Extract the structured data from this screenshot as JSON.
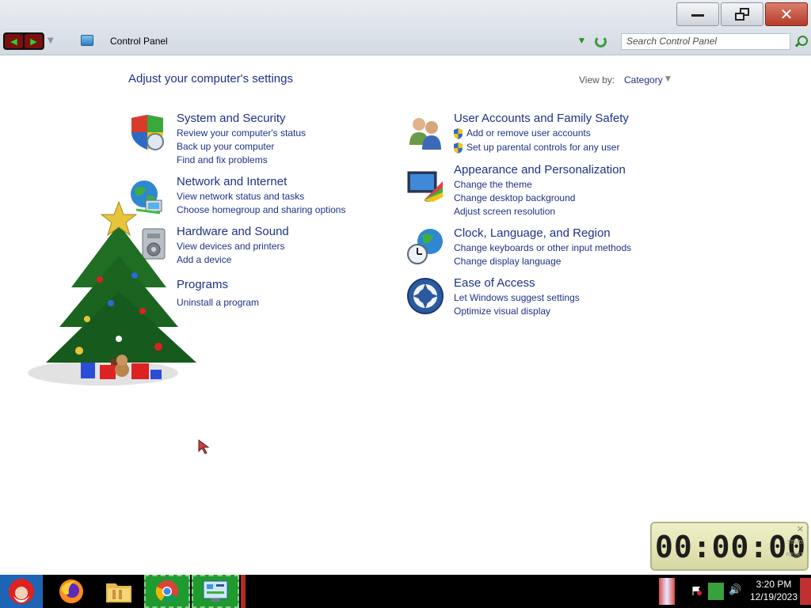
{
  "window": {
    "controls": {
      "minimize": "minimize",
      "maximize": "restore",
      "close": "close"
    }
  },
  "addressbar": {
    "breadcrumb": "Control Panel",
    "search_placeholder": "Search Control Panel"
  },
  "main": {
    "title": "Adjust your computer's settings",
    "view_by_label": "View by:",
    "view_by_value": "Category",
    "categories_left": [
      {
        "title": "System and Security",
        "icon": "shield-icon",
        "links": [
          "Review your computer's status",
          "Back up your computer",
          "Find and fix problems"
        ]
      },
      {
        "title": "Network and Internet",
        "icon": "globe-network-icon",
        "links": [
          "View network status and tasks",
          "Choose homegroup and sharing options"
        ]
      },
      {
        "title": "Hardware and Sound",
        "icon": "printer-speaker-icon",
        "links": [
          "View devices and printers",
          "Add a device"
        ]
      },
      {
        "title": "Programs",
        "icon": "programs-icon",
        "links": [
          "Uninstall a program"
        ]
      }
    ],
    "categories_right": [
      {
        "title": "User Accounts and Family Safety",
        "icon": "users-icon",
        "links": [
          "Add or remove user accounts",
          "Set up parental controls for any user"
        ]
      },
      {
        "title": "Appearance and Personalization",
        "icon": "display-paint-icon",
        "links": [
          "Change the theme",
          "Change desktop background",
          "Adjust screen resolution"
        ]
      },
      {
        "title": "Clock, Language, and Region",
        "icon": "clock-globe-icon",
        "links": [
          "Change keyboards or other input methods",
          "Change display language"
        ]
      },
      {
        "title": "Ease of Access",
        "icon": "ease-of-access-icon",
        "links": [
          "Let Windows suggest settings",
          "Optimize visual display"
        ]
      }
    ]
  },
  "timer": {
    "display": "00:00:00",
    "start_label": "START",
    "reset_label": "RESET"
  },
  "taskbar": {
    "items": [
      "start-icon",
      "firefox-icon",
      "file-explorer-icon",
      "chrome-icon",
      "control-panel-icon"
    ],
    "clock_time": "3:20 PM",
    "clock_date": "12/19/2023"
  },
  "colors": {
    "link": "#1e3287",
    "taskbar": "#000000",
    "active_task": "#1f9a2f",
    "close_button": "#c7503d"
  }
}
